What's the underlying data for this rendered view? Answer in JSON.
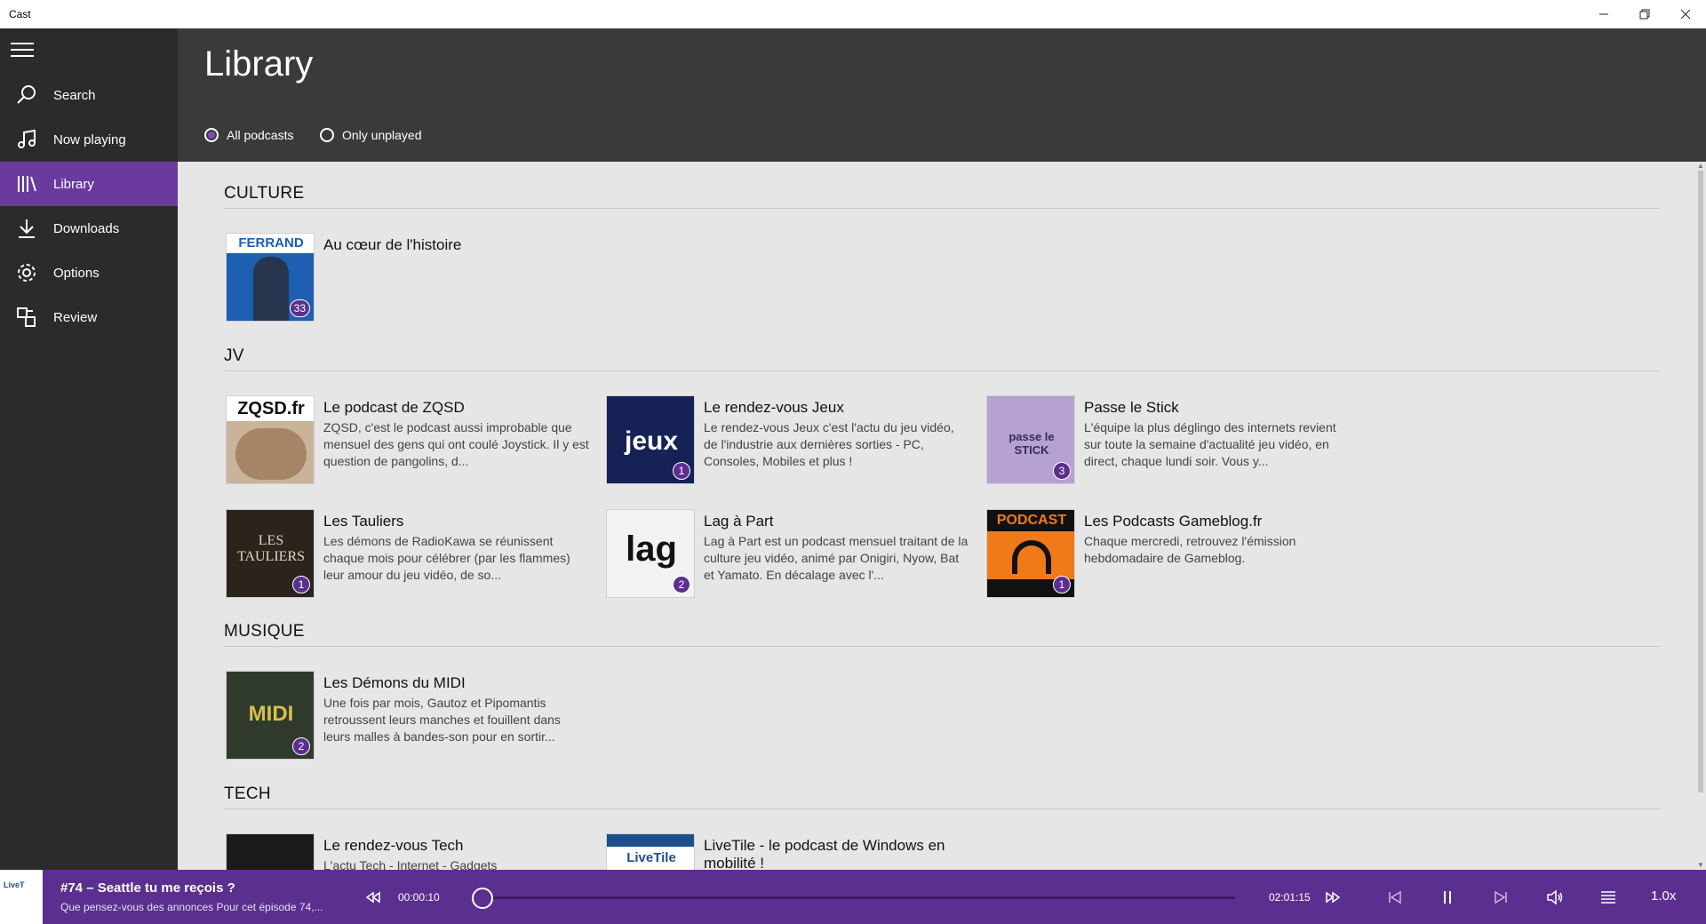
{
  "window": {
    "title": "Cast"
  },
  "sidebar": {
    "items": [
      {
        "label": "Search",
        "icon": "search-icon"
      },
      {
        "label": "Now playing",
        "icon": "music-note-icon"
      },
      {
        "label": "Library",
        "icon": "library-icon"
      },
      {
        "label": "Downloads",
        "icon": "download-icon"
      },
      {
        "label": "Options",
        "icon": "gear-icon"
      },
      {
        "label": "Review",
        "icon": "review-icon"
      }
    ],
    "active": "Library"
  },
  "header": {
    "title": "Library",
    "filters": [
      {
        "label": "All podcasts",
        "checked": true
      },
      {
        "label": "Only unplayed",
        "checked": false
      }
    ]
  },
  "sections": [
    {
      "title": "CULTURE",
      "podcasts": [
        {
          "title": "Au cœur de l'histoire",
          "description": "",
          "badge": "33",
          "art_text": "FERRAND"
        }
      ]
    },
    {
      "title": "JV",
      "podcasts": [
        {
          "title": "Le podcast de ZQSD",
          "description": "ZQSD, c'est le podcast aussi improbable que mensuel des gens qui ont coulé Joystick. Il y est question de pangolins, d...",
          "badge": "",
          "art_text": "ZQSD.fr"
        },
        {
          "title": "Le rendez-vous Jeux",
          "description": "Le rendez-vous Jeux c'est l'actu du jeu vidéo, de l'industrie aux dernières sorties - PC, Consoles, Mobiles et plus !",
          "badge": "1",
          "art_text": "jeux"
        },
        {
          "title": "Passe le Stick",
          "description": "L'équipe la plus déglingo des internets revient sur toute la semaine d'actualité jeu vidéo, en direct, chaque lundi soir. Vous y...",
          "badge": "3",
          "art_text": "passe le STICK"
        },
        {
          "title": "Les Tauliers",
          "description": "Les démons de RadioKawa se réunissent chaque mois pour célébrer (par les flammes) leur amour du jeu vidéo, de so...",
          "badge": "1",
          "art_text": "LES TAULIERS"
        },
        {
          "title": "Lag à Part",
          "description": "Lag à Part est un podcast mensuel traitant de la culture jeu vidéo, animé par Onigiri, Nyow, Bat et Yamato. En décalage avec l'...",
          "badge": "2",
          "art_text": "lag"
        },
        {
          "title": "Les Podcasts Gameblog.fr",
          "description": "Chaque mercredi, retrouvez l'émission hebdomadaire de Gameblog.",
          "badge": "1",
          "art_text": "PODCAST"
        }
      ]
    },
    {
      "title": "MUSIQUE",
      "podcasts": [
        {
          "title": "Les Démons du MIDI",
          "description": "Une fois par mois, Gautoz et Pipomantis retroussent leurs manches et fouillent dans leurs malles à bandes-son pour en sortir...",
          "badge": "2",
          "art_text": "MIDI"
        }
      ]
    },
    {
      "title": "TECH",
      "podcasts": [
        {
          "title": "Le rendez-vous Tech",
          "description": "L'actu Tech - Internet - Gadgets",
          "badge": "",
          "art_text": ""
        },
        {
          "title": "LiveTile - le podcast de Windows en mobilité !",
          "description": "",
          "badge": "",
          "art_text": "LiveTile"
        }
      ]
    }
  ],
  "player": {
    "episode_title": "#74 – Seattle tu me reçois ?",
    "episode_subtitle": "Que pensez-vous des annonces  Pour cet épisode 74,...",
    "elapsed": "00:00:10",
    "duration": "02:01:15",
    "progress": 0.0014,
    "speed": "1.0x",
    "art_text": "LiveT"
  },
  "colors": {
    "accent": "#5b2f8f",
    "nav_active": "#6a3a9f",
    "sidebar": "#2b2b2b",
    "header": "#3a3a3a"
  }
}
